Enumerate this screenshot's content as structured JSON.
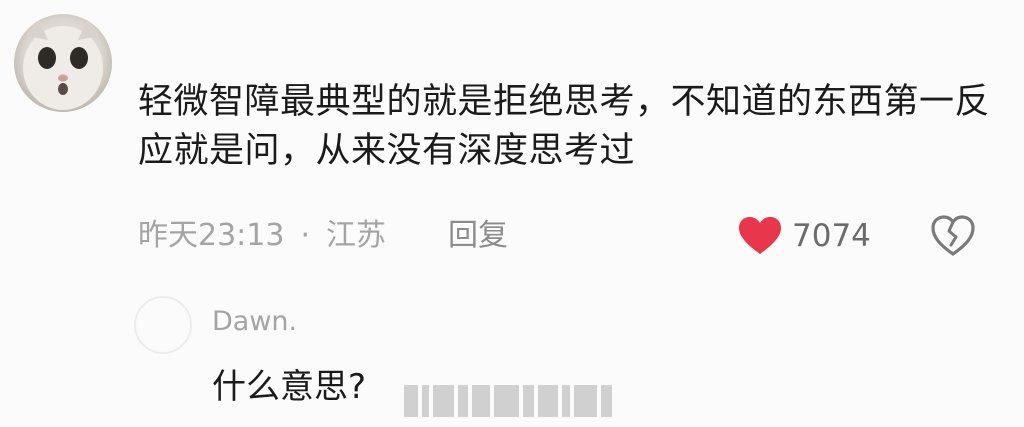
{
  "comment": {
    "text": "轻微智障最典型的就是拒绝思考，不知道的东西第一反应就是问，从来没有深度思考过",
    "time": "昨天23:13",
    "separator": "·",
    "location": "江苏",
    "reply_label": "回复",
    "like_count": "7074",
    "colors": {
      "like": "#e8374a",
      "text": "#1b1b1b",
      "meta": "#a4a4a4"
    },
    "icons": {
      "avatar": "cat-face-avatar",
      "like": "heart-icon",
      "dislike": "broken-heart-icon"
    }
  },
  "reply": {
    "username": "Dawn.",
    "text": "什么意思?"
  }
}
